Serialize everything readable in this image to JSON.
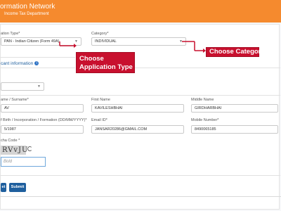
{
  "header": {
    "title": "ormation Network",
    "subtitle": "Income Tax Department"
  },
  "application_type": {
    "label": "ation Type*",
    "value": "PAN - Indian Citizen (Form 49A)"
  },
  "category": {
    "label": "Category*",
    "value": "INDIVIDUAL"
  },
  "callouts": {
    "application_type_line1": "Choose",
    "application_type_line2": "Application Type",
    "category": "Choose Category"
  },
  "applicant_section": {
    "title": "cant information"
  },
  "title_field": {
    "value": ""
  },
  "last_name": {
    "label": "ame / Surname*",
    "value": "AV"
  },
  "first_name": {
    "label": "First Name",
    "value": "KAVILESHBHAI"
  },
  "middle_name": {
    "label": "Middle Name",
    "value": "GIRDHARBHAI"
  },
  "dob": {
    "label": "f Birth / Incorporation / Formation (DD/MM/YYYY)*",
    "value": "5/1987"
  },
  "email": {
    "label": "Email ID*",
    "value": "JANSAR20286@GMAIL.COM"
  },
  "mobile": {
    "label": "Mobile Number*",
    "value": "8490065185"
  },
  "captcha": {
    "label": "cha Code *",
    "text": "RVvJU",
    "input_placeholder": "Bold"
  },
  "buttons": {
    "reset": "et",
    "submit": "Submit"
  },
  "colors": {
    "header_bg": "#f58a2e",
    "callout_bg": "#c8102e",
    "button_bg": "#1f5f9e",
    "link_blue": "#1f5f9e"
  }
}
